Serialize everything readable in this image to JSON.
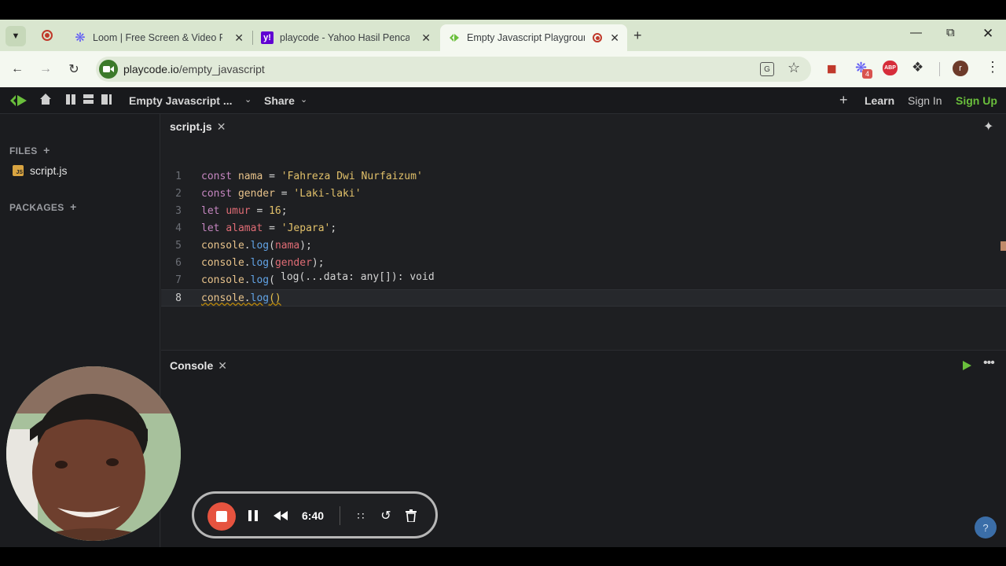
{
  "browser": {
    "tabs": [
      {
        "title": "Loom | Free Screen & Video Re"
      },
      {
        "title": "playcode - Yahoo Hasil Pencaria"
      },
      {
        "title": "Empty Javascript Playgroun"
      }
    ],
    "url_host": "playcode.io",
    "url_path": "/empty_javascript",
    "profile_initial": "r",
    "ext_badge": "4"
  },
  "app": {
    "project_title": "Empty Javascript ...",
    "share_label": "Share",
    "learn_label": "Learn",
    "signin_label": "Sign In",
    "signup_label": "Sign Up",
    "accent_color": "#6abf3c"
  },
  "sidebar": {
    "files_label": "FILES",
    "file_name": "script.js",
    "packages_label": "PACKAGES"
  },
  "editor": {
    "tab_label": "script.js",
    "lines": [
      {
        "n": "1",
        "code": "const nama = 'Fahreza Dwi Nurfaizum'"
      },
      {
        "n": "2",
        "code": "const gender = 'Laki-laki'"
      },
      {
        "n": "3",
        "code": "let umur = 16;"
      },
      {
        "n": "4",
        "code": "let alamat = 'Jepara';"
      },
      {
        "n": "5",
        "code": "console.log(nama);"
      },
      {
        "n": "6",
        "code": "console.log(gender);"
      },
      {
        "n": "7",
        "code": "console.log("
      },
      {
        "n": "8",
        "code": "console.log()"
      }
    ],
    "tooltip": "log(...data: any[]): void"
  },
  "console": {
    "tab_label": "Console"
  },
  "recorder": {
    "time": "6:40"
  },
  "help_label": "?"
}
